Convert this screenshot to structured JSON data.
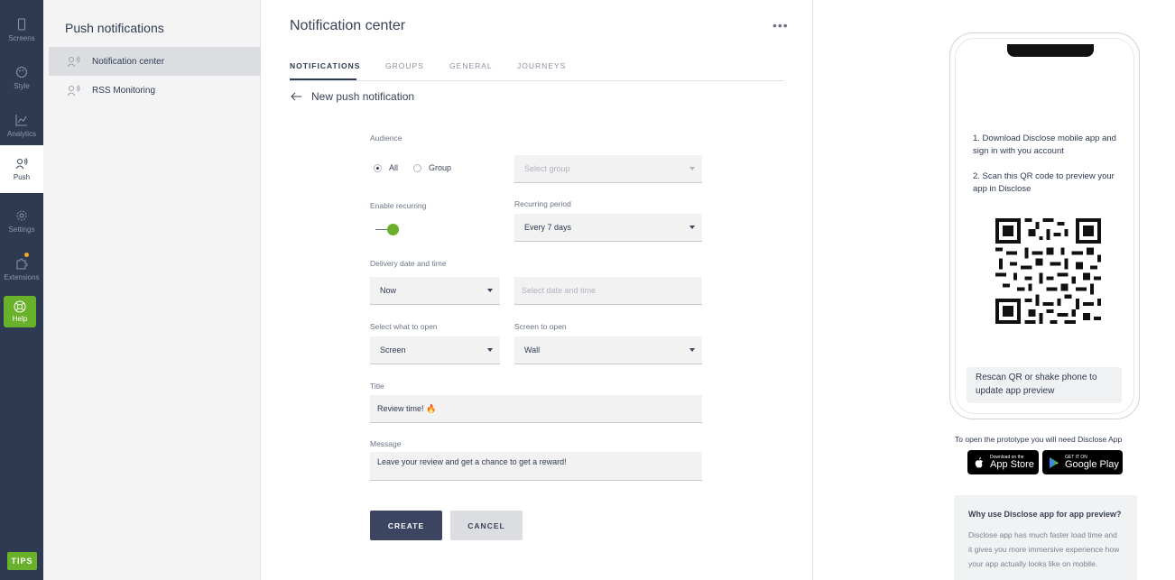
{
  "rail": {
    "items": [
      {
        "label": "Screens",
        "icon": "phone-icon"
      },
      {
        "label": "Style",
        "icon": "palette-icon"
      },
      {
        "label": "Analytics",
        "icon": "chart-icon"
      },
      {
        "label": "Push",
        "icon": "push-icon"
      },
      {
        "label": "Settings",
        "icon": "gear-icon"
      },
      {
        "label": "Extensions",
        "icon": "puzzle-icon"
      },
      {
        "label": "Help",
        "icon": "lifebuoy-icon"
      }
    ],
    "tips_label": "TIPS",
    "accent": "#6ab12b"
  },
  "subnav": {
    "title": "Push notifications",
    "items": [
      {
        "label": "Notification center"
      },
      {
        "label": "RSS Monitoring"
      }
    ]
  },
  "main": {
    "title": "Notification center",
    "more_label": "•••",
    "tabs": [
      {
        "label": "NOTIFICATIONS"
      },
      {
        "label": "GROUPS"
      },
      {
        "label": "GENERAL"
      },
      {
        "label": "JOURNEYS"
      }
    ],
    "back_label": "New push notification",
    "form": {
      "audience_label": "Audience",
      "audience_all": "All",
      "audience_group": "Group",
      "group_placeholder": "Select group",
      "recurring_label": "Enable recurring",
      "recurring_enabled": true,
      "period_label": "Recurring period",
      "period_value": "Every 7 days",
      "delivery_label": "Delivery date and time",
      "delivery_value": "Now",
      "datetime_placeholder": "Select date and time",
      "open_label": "Select what to open",
      "open_value": "Screen",
      "screen_label": "Screen to open",
      "screen_value": "Wall",
      "title_label": "Title",
      "title_value": "Review time! 🔥",
      "message_label": "Message",
      "message_value": "Leave your review and get a chance to get a reward!",
      "create_label": "CREATE",
      "cancel_label": "CANCEL"
    }
  },
  "preview": {
    "step1": "1. Download Disclose mobile app and sign in with you account",
    "step2": "2. Scan this QR code to preview your app in Disclose",
    "rescan": "Rescan QR or shake phone to update app preview",
    "prototype_note": "To open the prototype you will need Disclose App",
    "appstore_small": "Download on the",
    "appstore_big": "App Store",
    "googleplay_small": "GET IT ON",
    "googleplay_big": "Google Play",
    "why_title": "Why use Disclose app for app preview?",
    "why_body": "Disclose app has much faster load time and it gives you more immersive experience how your app actually looks like on mobile."
  }
}
